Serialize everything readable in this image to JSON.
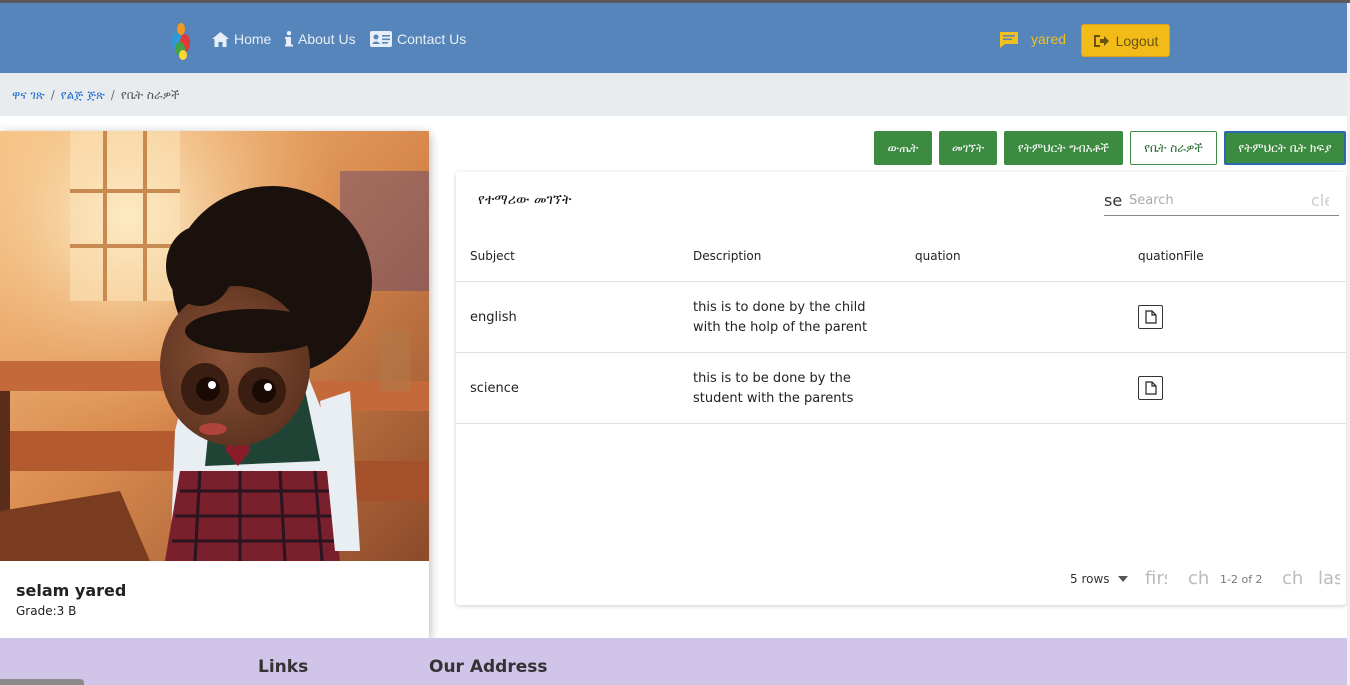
{
  "nav": {
    "home": "Home",
    "about": "About Us",
    "contact": "Contact Us",
    "username": "yared",
    "logout": "Logout"
  },
  "breadcrumb": [
    "ዋና ገጽ",
    "የልጅ ጅጽ",
    "የቤት ስራዎች"
  ],
  "student": {
    "name": "selam yared",
    "grade": "Grade:3 B"
  },
  "actions": [
    "ውጤት",
    "መገኘት",
    "የትምህርት ግብአቶች",
    "የቤት ስራዎች",
    "የትምህርት ቤት ክፍያ"
  ],
  "table": {
    "title": "የተማሪው መገኘት",
    "search_icon_text": "se",
    "search_placeholder": "Search",
    "clear_text": "cle",
    "columns": [
      "Subject",
      "Description",
      "quation",
      "quationFile"
    ],
    "rows": [
      {
        "subject": "english",
        "description_1": "this is to done by the child",
        "description_2": "with the holp of the parent",
        "quation": ""
      },
      {
        "subject": "science",
        "description_1": "this is to be done by the",
        "description_2": "student with the parents",
        "quation": ""
      }
    ]
  },
  "pager": {
    "rows_label": "5 rows",
    "first": "firs",
    "prev": "ch",
    "count": "1-2 of 2",
    "next": "ch",
    "last": "las"
  },
  "footer": {
    "links": "Links",
    "address": "Our Address"
  },
  "colors": {
    "navbar": "#5585bb",
    "accent_yellow": "#f2bb18",
    "button_green": "#3d8b40",
    "footer": "#d0c4e8"
  }
}
